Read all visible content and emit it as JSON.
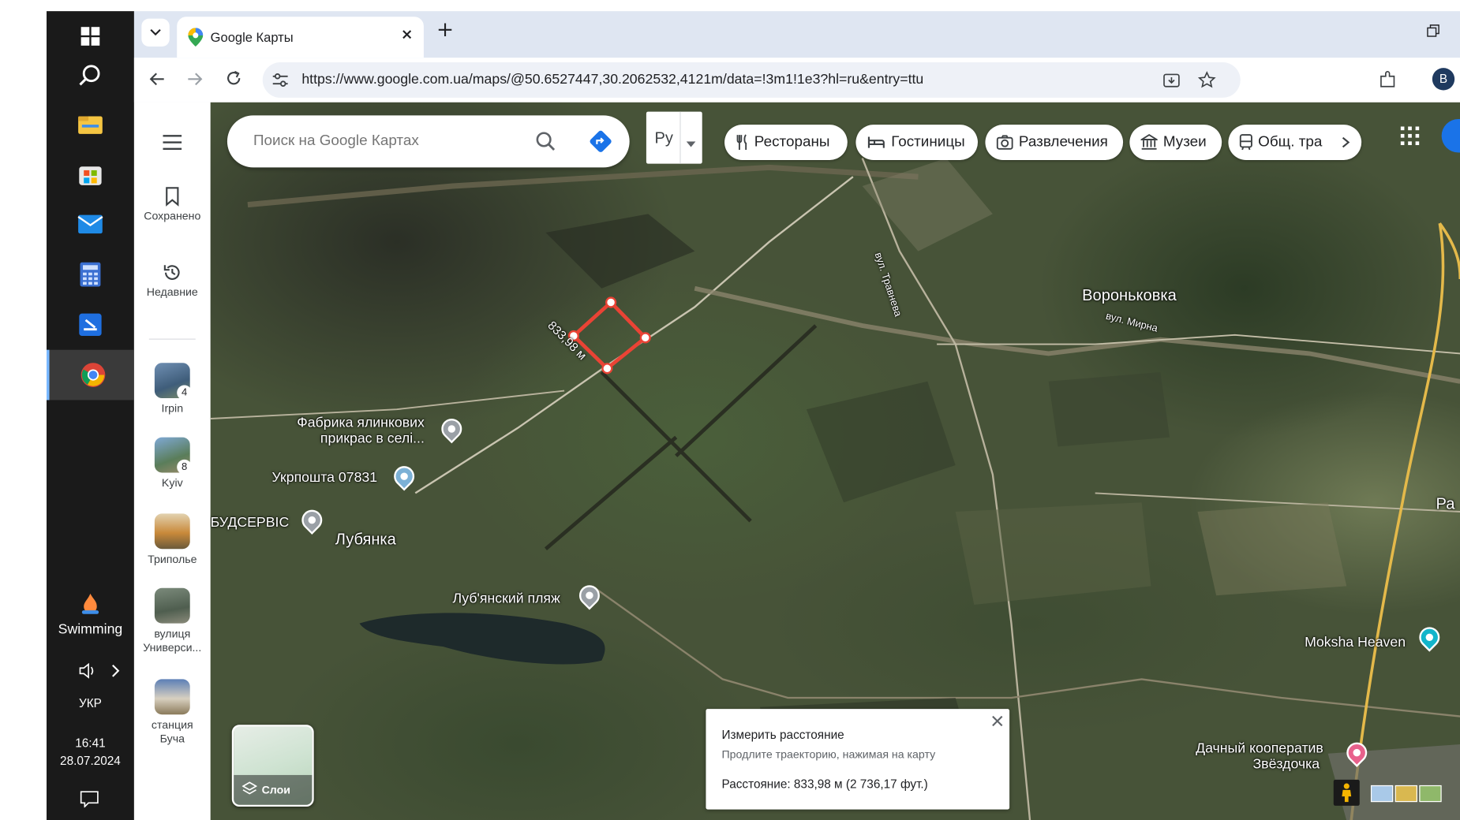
{
  "taskbar": {
    "weather": "Swimming",
    "language": "УКР",
    "time": "16:41",
    "date": "28.07.2024",
    "icons": [
      "windows-start-icon",
      "search-icon",
      "file-explorer-icon",
      "microsoft-store-icon",
      "mail-icon",
      "calculator-icon",
      "app-icon",
      "chrome-icon"
    ]
  },
  "browser": {
    "tab_title": "Google Карты",
    "url": "https://www.google.com.ua/maps/@50.6527447,30.2062532,4121m/data=!3m1!1e3?hl=ru&entry=ttu",
    "profile_initial": "В",
    "colors": {
      "chrome_bg": "#dfe6f2",
      "accent": "#1a73e8"
    }
  },
  "maps_rail": {
    "saved": "Сохранено",
    "recent": "Недавние",
    "places": [
      {
        "label": "Irpin",
        "badge": "4"
      },
      {
        "label": "Kyiv",
        "badge": "8"
      },
      {
        "label": "Триполье",
        "badge": ""
      },
      {
        "label": "вулиця Универси...",
        "badge": ""
      },
      {
        "label": "станция Буча",
        "badge": ""
      }
    ],
    "layers": "Слои"
  },
  "search": {
    "placeholder": "Поиск на Google Картах",
    "language_select": "Ру"
  },
  "categories": [
    "Рестораны",
    "Гостиницы",
    "Развлечения",
    "Музеи",
    "Общ. тра"
  ],
  "map_labels": {
    "village1": "Вороньковка",
    "street1": "вул. Травнева",
    "street2": "вул. Мирна",
    "village2": "Лубянка",
    "factory_line1": "Фабрика ялинкових",
    "factory_line2": "прикрас в селі...",
    "post": "Укрпошта 07831",
    "build": "БУДСЕРВІС",
    "beach": "Луб'янский пляж",
    "moksha": "Moksha Heaven",
    "coop_line1": "Дачный кооператив",
    "coop_line2": "Звёздочка",
    "edge": "Ра",
    "measure_label": "833,98 м"
  },
  "measure_panel": {
    "title": "Измерить расстояние",
    "hint": "Продлите траекторию, нажимая на карту",
    "distance": "Расстояние: 833,98 м (2 736,17 фут.)"
  }
}
